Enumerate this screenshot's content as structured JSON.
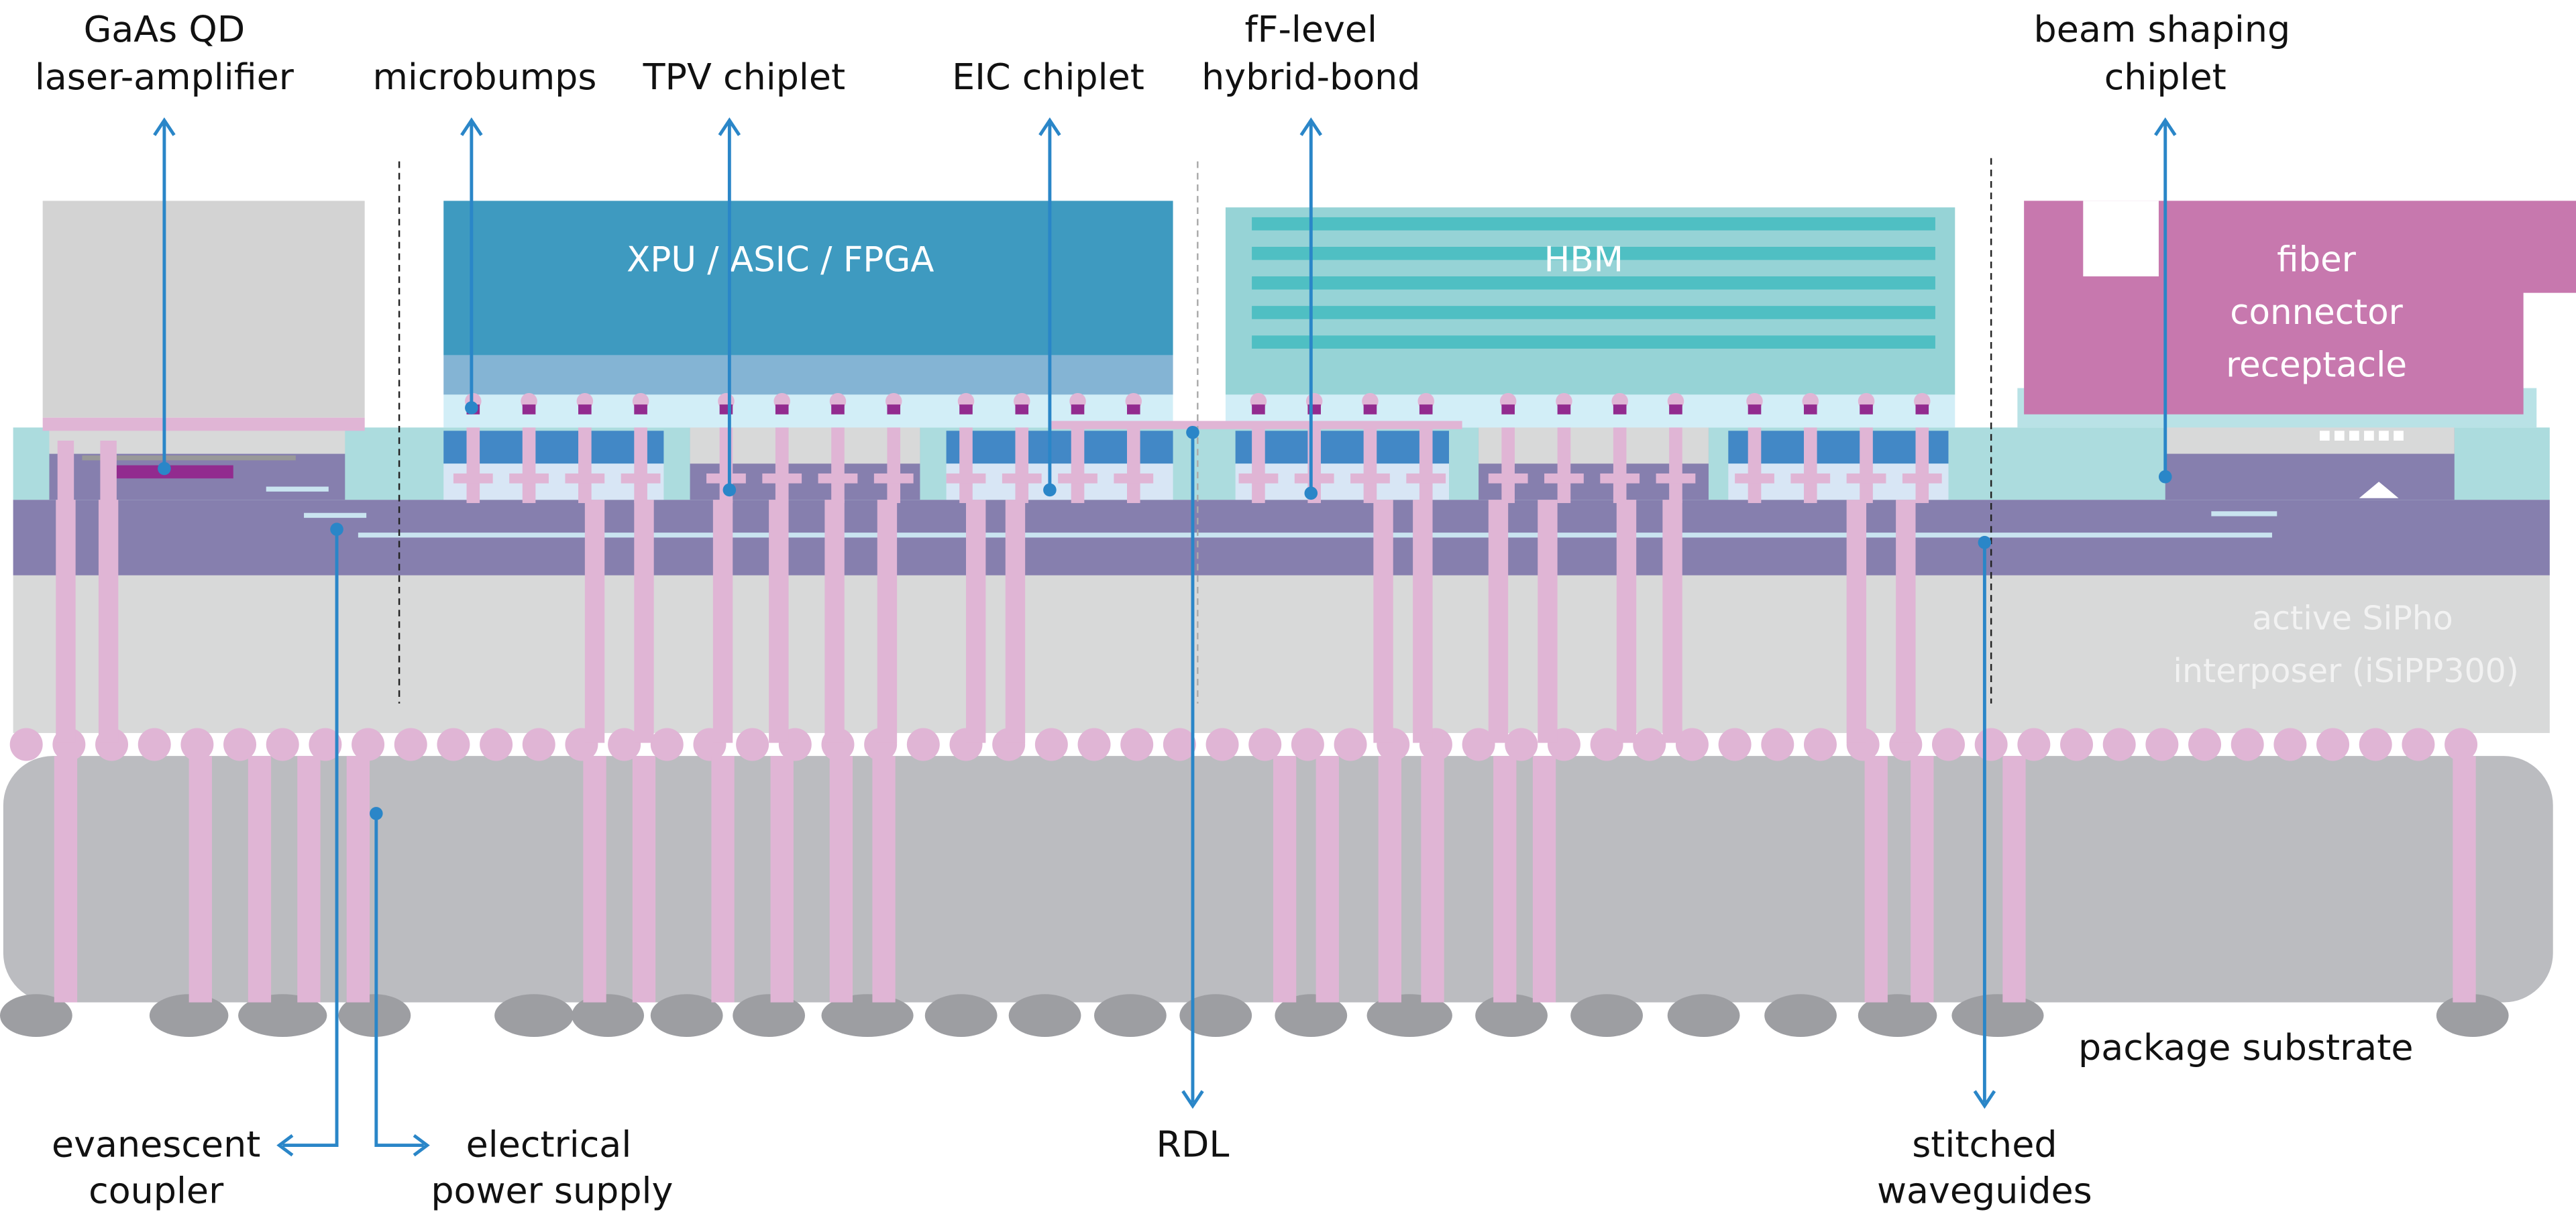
{
  "colors": {
    "substrate": "#bbbcc0",
    "ball": "#9d9ea2",
    "interposer": "#d8d9d9",
    "photonic_layer": "#867fae",
    "via": "#e0b5d5",
    "mold": "#acdcde",
    "xpu": "#3e9ac0",
    "hbm_body": "#96d3d6",
    "hbm_stripe": "#4fbfc3",
    "fiber_connector": "#c778ae",
    "eic": "#4288c6",
    "pointer": "#2a86c8"
  },
  "chips": {
    "xpu_label": "XPU / ASIC / FPGA",
    "hbm_label": "HBM",
    "fiber_connector_label": [
      "fiber",
      "connector",
      "receptacle"
    ]
  },
  "interposer": {
    "label": [
      "active SiPho",
      "interposer (iSiPP300)"
    ]
  },
  "callouts": {
    "top": [
      {
        "id": "gaas-qd",
        "lines": [
          "GaAs QD",
          "laser-amplifier"
        ]
      },
      {
        "id": "microbumps",
        "lines": [
          "microbumps"
        ]
      },
      {
        "id": "tpv-chiplet",
        "lines": [
          "TPV chiplet"
        ]
      },
      {
        "id": "eic-chiplet",
        "lines": [
          "EIC chiplet"
        ]
      },
      {
        "id": "hybrid-bond",
        "lines": [
          "fF-level",
          "hybrid-bond"
        ]
      },
      {
        "id": "beam-shaping",
        "lines": [
          "beam shaping",
          "chiplet"
        ]
      }
    ],
    "bottom": [
      {
        "id": "evanescent-coupler",
        "lines": [
          "evanescent",
          "coupler"
        ]
      },
      {
        "id": "power-supply",
        "lines": [
          "electrical",
          "power supply"
        ]
      },
      {
        "id": "rdl",
        "lines": [
          "RDL"
        ]
      },
      {
        "id": "stitched-waveguides",
        "lines": [
          "stitched",
          "waveguides"
        ]
      }
    ],
    "package_substrate": "package substrate"
  }
}
